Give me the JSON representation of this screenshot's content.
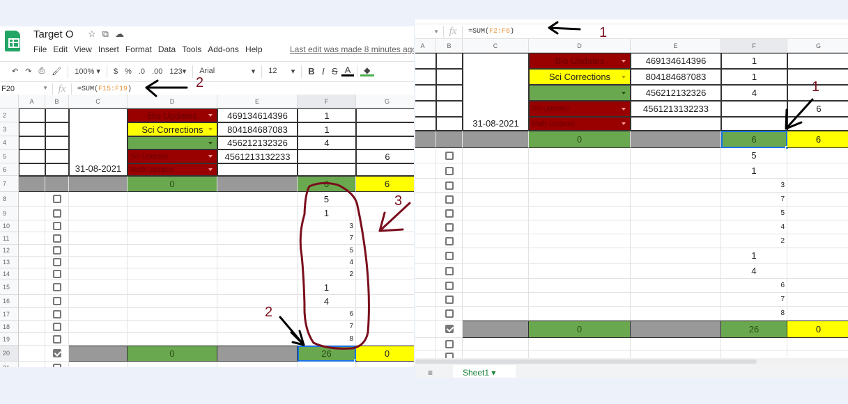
{
  "left_panel": {
    "doc_title": "Target O",
    "title_icons": [
      "star-icon",
      "move-to-folder-icon",
      "cloud-status-icon"
    ],
    "menu": [
      "File",
      "Edit",
      "View",
      "Insert",
      "Format",
      "Data",
      "Tools",
      "Add-ons",
      "Help"
    ],
    "last_edit": "Last edit was made 8 minutes ago",
    "toolbar": {
      "zoom": "100%",
      "currency": "$",
      "percent": "%",
      "decrease_decimal": ".0",
      "increase_decimal": ".00",
      "more_formats": "123",
      "font": "Arial",
      "font_size": "12",
      "bold": "B",
      "italic": "I",
      "strike": "S",
      "text_color": "A",
      "fill": "◆"
    },
    "name_box": "F20",
    "formula_prefix": "=SUM(",
    "formula_ref": "F15:F19",
    "formula_suffix": ")",
    "annotations": [
      "2",
      "2",
      "3"
    ]
  },
  "right_panel": {
    "formula_prefix": "=SUM(",
    "formula_ref": "F2:F6",
    "formula_suffix": ")",
    "annotations": [
      "1",
      "1"
    ],
    "sheet_tab": "Sheet1"
  },
  "grid": {
    "columns": [
      "A",
      "B",
      "C",
      "D",
      "E",
      "F",
      "G"
    ],
    "rows_top": [
      {
        "num": "2",
        "D": "Bio Updates",
        "D_style": "red",
        "E": "469134614396",
        "F": "1",
        "G": ""
      },
      {
        "num": "3",
        "D": "Sci Corrections",
        "D_style": "yellow",
        "E": "804184687083",
        "F": "1",
        "G": ""
      },
      {
        "num": "4",
        "D": "",
        "D_style": "green",
        "E": "456212132326",
        "F": "4",
        "G": ""
      },
      {
        "num": "5",
        "D": "Sci Updates",
        "D_style": "red-small",
        "E": "4561213132233",
        "F": "",
        "G": "6"
      },
      {
        "num": "6",
        "D": "Math Updates",
        "D_style": "red-small",
        "E": "",
        "F": "",
        "G": ""
      }
    ],
    "date": "31-08-2021",
    "total_row_7": {
      "num": "7",
      "D": "0",
      "F": "6",
      "G": "6"
    },
    "rows_detail": [
      {
        "num": "8",
        "F": "5",
        "align": "center"
      },
      {
        "num": "9",
        "F": "1",
        "align": "center"
      },
      {
        "num": "10",
        "F": "3",
        "align": "right"
      },
      {
        "num": "11",
        "F": "7",
        "align": "right"
      },
      {
        "num": "12",
        "F": "5",
        "align": "right"
      },
      {
        "num": "13",
        "F": "4",
        "align": "right"
      },
      {
        "num": "14",
        "F": "2",
        "align": "right"
      },
      {
        "num": "15",
        "F": "1",
        "align": "center"
      },
      {
        "num": "16",
        "F": "4",
        "align": "center"
      },
      {
        "num": "17",
        "F": "6",
        "align": "right"
      },
      {
        "num": "18",
        "F": "7",
        "align": "right"
      },
      {
        "num": "19",
        "F": "8",
        "align": "right"
      }
    ],
    "total_row_20": {
      "num": "20",
      "D": "0",
      "F": "26",
      "G": "0",
      "checked": true
    },
    "row_21": {
      "num": "21"
    }
  },
  "colors": {
    "red": "#990000",
    "yellow": "#ffff00",
    "green": "#6aa84f",
    "gray": "#999999",
    "annotation": "#7a0e1d",
    "selection": "#1a73e8"
  }
}
